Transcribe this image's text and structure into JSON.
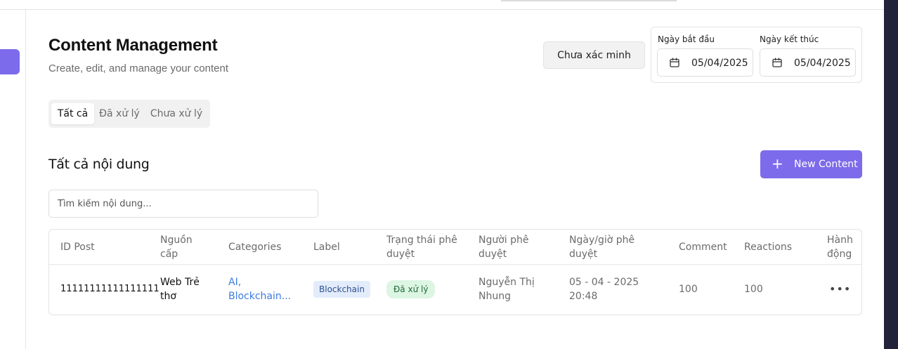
{
  "header": {
    "title": "Content Management",
    "subtitle": "Create, edit, and manage your content"
  },
  "filters": {
    "unverified_label": "Chưa xác minh",
    "start_date_label": "Ngày bắt đầu",
    "start_date_value": "05/04/2025",
    "end_date_label": "Ngày kết thúc",
    "end_date_value": "05/04/2025"
  },
  "tabs": [
    {
      "label": "Tất cả",
      "active": true
    },
    {
      "label": "Đã xử lý",
      "active": false
    },
    {
      "label": "Chưa xử lý",
      "active": false
    }
  ],
  "section": {
    "title": "Tất cả nội dung",
    "new_button_label": "New Content",
    "new_button_icon": "plus-icon"
  },
  "search": {
    "placeholder": "Tìm kiếm nội dung..."
  },
  "table": {
    "columns": [
      "ID Post",
      "Nguồn cấp",
      "Categories",
      "Label",
      "Trạng thái phê duyệt",
      "Người phê duyệt",
      "Ngày/giờ phê duyệt",
      "Comment",
      "Reactions",
      "Hành động"
    ],
    "rows": [
      {
        "id_post": "11111111111111111",
        "source": "Web Trẻ thơ",
        "categories": "AI, Blockchain...",
        "label": "Blockchain",
        "status": "Đã xử lý",
        "approver": "Nguyễn Thị Nhung",
        "approved_at": "05 - 04 - 2025 20:48",
        "comment": "100",
        "reactions": "100",
        "action_icon": "more-horizontal-icon"
      }
    ]
  },
  "colors": {
    "accent": "#7c6bea",
    "link": "#3d7be0",
    "badge_blue_bg": "#e3ecfb",
    "badge_green_bg": "#ddf5e3"
  }
}
